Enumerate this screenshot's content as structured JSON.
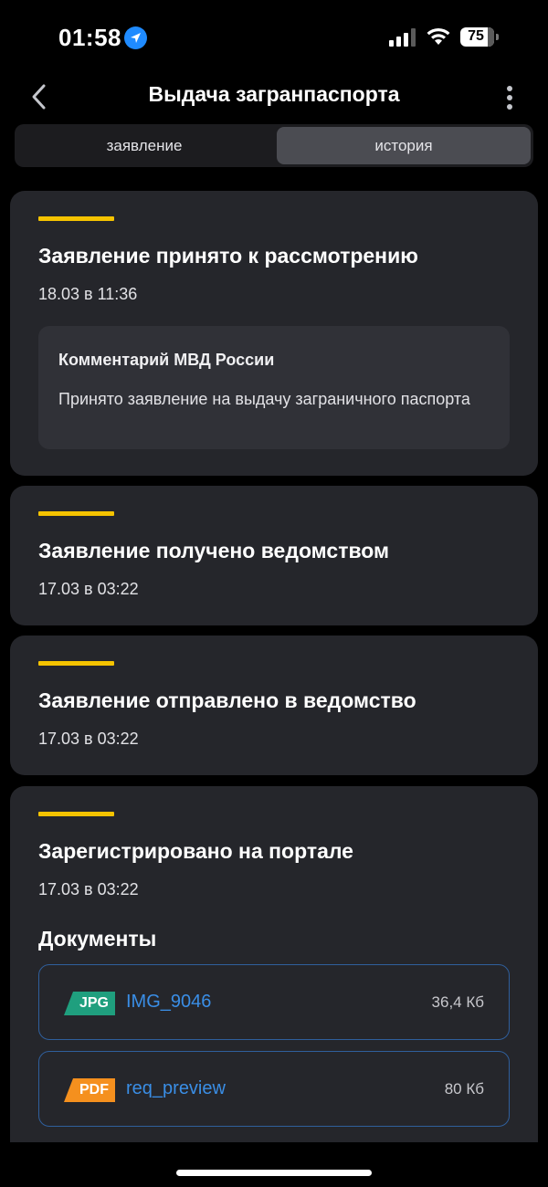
{
  "status_bar": {
    "time": "01:58",
    "battery": "75"
  },
  "nav": {
    "title": "Выдача загранпаспорта"
  },
  "tabs": [
    {
      "label": "заявление",
      "active": false
    },
    {
      "label": "история",
      "active": true
    }
  ],
  "history": [
    {
      "title": "Заявление принято к рассмотрению",
      "date": "18.03 в 11:36",
      "comment": {
        "author": "Комментарий МВД России",
        "text": "Принято заявление на выдачу заграничного паспорта"
      }
    },
    {
      "title": "Заявление получено ведомством",
      "date": "17.03 в 03:22"
    },
    {
      "title": "Заявление отправлено в ведомство",
      "date": "17.03 в 03:22"
    },
    {
      "title": "Зарегистрировано на портале",
      "date": "17.03 в 03:22",
      "documents_title": "Документы",
      "documents": [
        {
          "type": "JPG",
          "name": "IMG_9046",
          "size": "36,4 Кб",
          "color": "#1f9f7e"
        },
        {
          "type": "PDF",
          "name": "req_preview",
          "size": "80 Кб",
          "color": "#f5901e"
        }
      ]
    }
  ],
  "colors": {
    "accent": "#f5c300",
    "link": "#3a8ee6",
    "card": "#25262b"
  }
}
